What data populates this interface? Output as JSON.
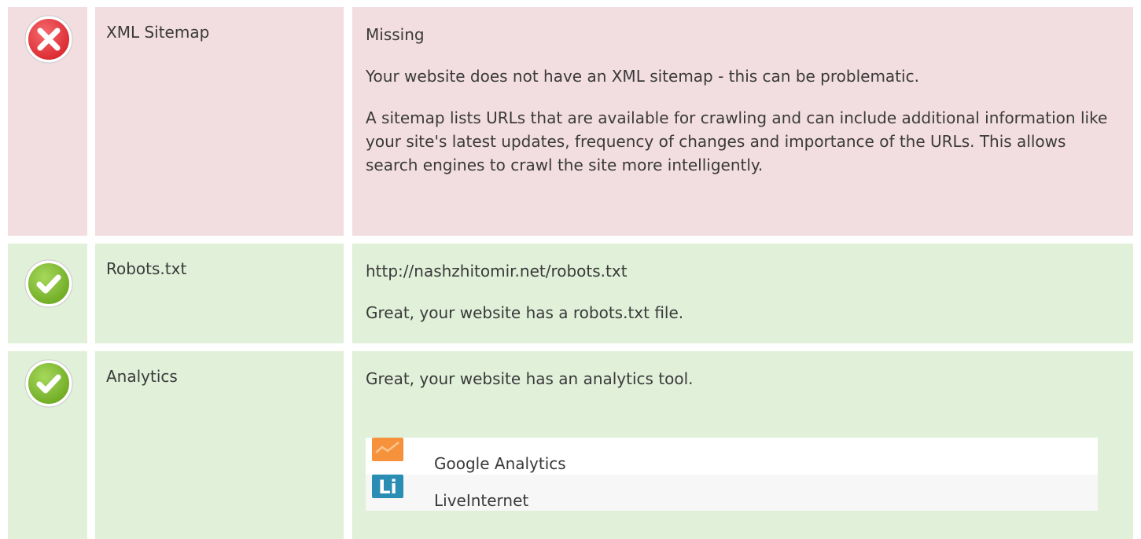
{
  "rows": [
    {
      "status": "fail",
      "label": "XML Sitemap",
      "value": "Missing",
      "message": "Your website does not have an XML sitemap - this can be problematic.",
      "description": "A sitemap lists URLs that are available for crawling and can include additional information like your site's latest updates, frequency of changes and importance of the URLs. This allows search engines to crawl the site more intelligently."
    },
    {
      "status": "pass",
      "label": "Robots.txt",
      "value": "http://nashzhitomir.net/robots.txt",
      "message": "Great, your website has a robots.txt file."
    },
    {
      "status": "pass",
      "label": "Analytics",
      "message": "Great, your website has an analytics tool.",
      "tools": [
        {
          "name": "Google Analytics",
          "icon": "google-analytics-icon"
        },
        {
          "name": "LiveInternet",
          "icon": "liveinternet-icon",
          "logo_text": "Li"
        }
      ]
    }
  ],
  "colors": {
    "fail_bg": "#f2dde0",
    "pass_bg": "#e0f0d9",
    "fail_icon": "#e2333a",
    "pass_icon": "#7cbb2e",
    "ga_orange": "#f6923b",
    "li_blue": "#2a8db4"
  }
}
